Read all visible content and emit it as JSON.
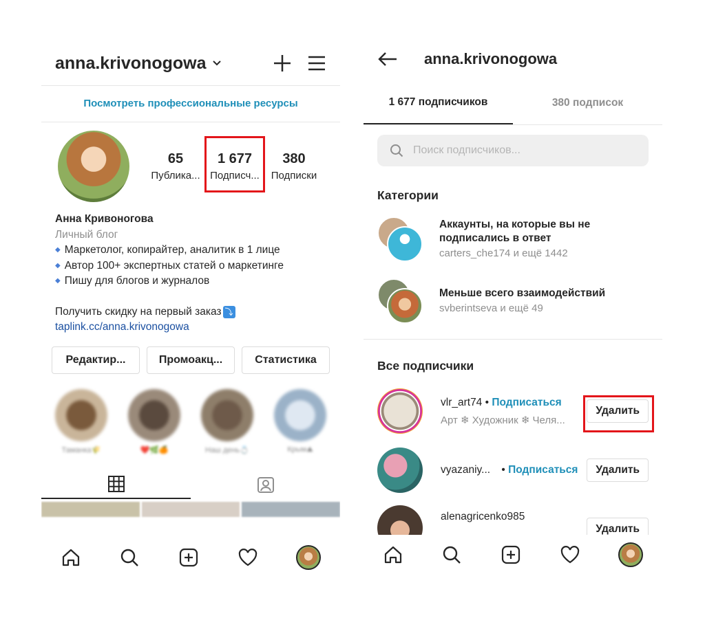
{
  "left": {
    "username": "anna.krivonogowa",
    "pro_link": "Посмотреть профессиональные ресурсы",
    "stats": [
      {
        "value": "65",
        "label": "Публика..."
      },
      {
        "value": "1 677",
        "label": "Подписч..."
      },
      {
        "value": "380",
        "label": "Подписки"
      }
    ],
    "bio": {
      "name": "Анна Кривоногова",
      "category": "Личный блог",
      "lines": [
        "Маркетолог, копирайтер, аналитик в 1 лице",
        "Автор 100+ экспертных статей о маркетинге",
        "Пишу для блогов и журналов"
      ],
      "bullet": "◆",
      "promo": "Получить скидку на первый заказ",
      "promo_icon": "⤵",
      "link": "taplink.cc/anna.krivonogowa"
    },
    "buttons": [
      "Редактир...",
      "Промоакц...",
      "Статистика"
    ],
    "stories": [
      "Таманка🌾",
      "❤️🌿🍊",
      "Наш день💍",
      "Крым⛰"
    ],
    "nav_icons": [
      "home-icon",
      "search-icon",
      "plus-square-icon",
      "heart-icon",
      "profile-avatar"
    ]
  },
  "right": {
    "title": "anna.krivonogowa",
    "tabs": [
      "1 677 подписчиков",
      "380 подписок"
    ],
    "search_placeholder": "Поиск подписчиков...",
    "categories_title": "Категории",
    "categories": [
      {
        "title_line1": "Аккаунты, на которые вы не",
        "title_line2": "подписались в ответ",
        "sub": "carters_che174 и ещё 1442"
      },
      {
        "title_line1": "Меньше всего взаимодействий",
        "title_line2": "",
        "sub": "svberintseva и ещё 49"
      }
    ],
    "all_title": "Все подписчики",
    "followers": [
      {
        "name": "vlr_art74",
        "dot": " • ",
        "follow": "Подписаться",
        "sub": "Арт ❄ Художник ❄ Челя...",
        "remove": "Удалить"
      },
      {
        "name": "vyazaniy...",
        "dot": " • ",
        "follow": "Подписаться",
        "sub": "",
        "remove": "Удалить"
      },
      {
        "name": "alenagricenko985",
        "dot": "",
        "follow": "",
        "sub": "",
        "remove": "Удалить"
      }
    ]
  },
  "colors": {
    "accent": "#1f8fb8",
    "highlight": "#e3151a"
  }
}
